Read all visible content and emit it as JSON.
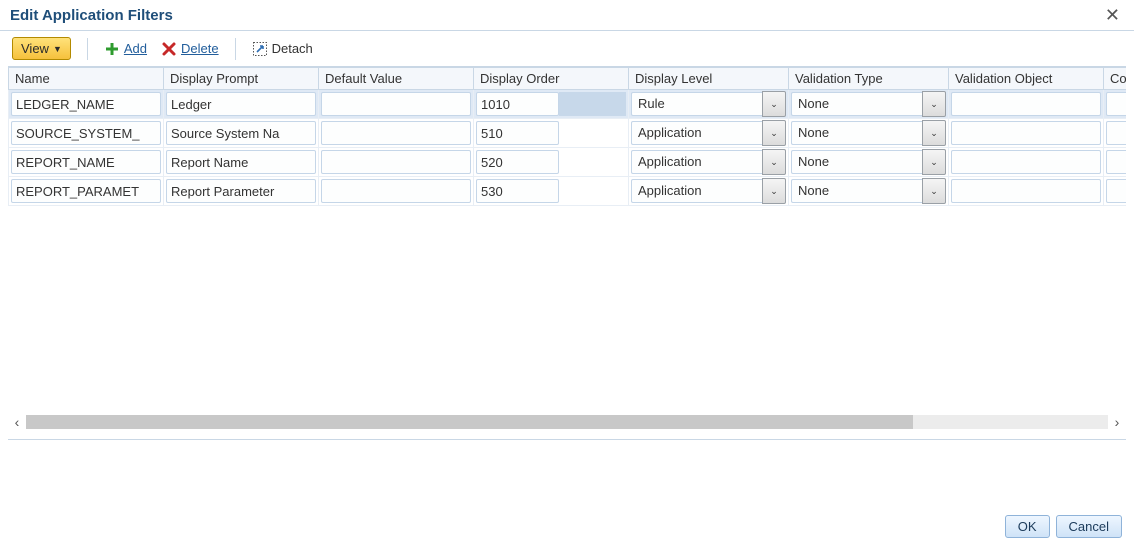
{
  "title": "Edit Application Filters",
  "toolbar": {
    "view_label": "View",
    "add_label": "Add",
    "delete_label": "Delete",
    "detach_label": "Detach"
  },
  "columns": {
    "name": "Name",
    "display_prompt": "Display Prompt",
    "default_value": "Default Value",
    "display_order": "Display Order",
    "display_level": "Display Level",
    "validation_type": "Validation Type",
    "validation_object": "Validation Object",
    "condition": "Co"
  },
  "rows": [
    {
      "selected": true,
      "name": "LEDGER_NAME",
      "display_prompt": "Ledger",
      "default_value": "",
      "display_order": "1010",
      "display_level": "Rule",
      "validation_type": "None",
      "validation_object": ""
    },
    {
      "selected": false,
      "name": "SOURCE_SYSTEM_",
      "display_prompt": "Source System Na",
      "default_value": "",
      "display_order": "510",
      "display_level": "Application",
      "validation_type": "None",
      "validation_object": ""
    },
    {
      "selected": false,
      "name": "REPORT_NAME",
      "display_prompt": "Report Name",
      "default_value": "",
      "display_order": "520",
      "display_level": "Application",
      "validation_type": "None",
      "validation_object": ""
    },
    {
      "selected": false,
      "name": "REPORT_PARAMET",
      "display_prompt": "Report Parameter ",
      "default_value": "",
      "display_order": "530",
      "display_level": "Application",
      "validation_type": "None",
      "validation_object": ""
    }
  ],
  "footer": {
    "ok_label": "OK",
    "cancel_label": "Cancel"
  }
}
